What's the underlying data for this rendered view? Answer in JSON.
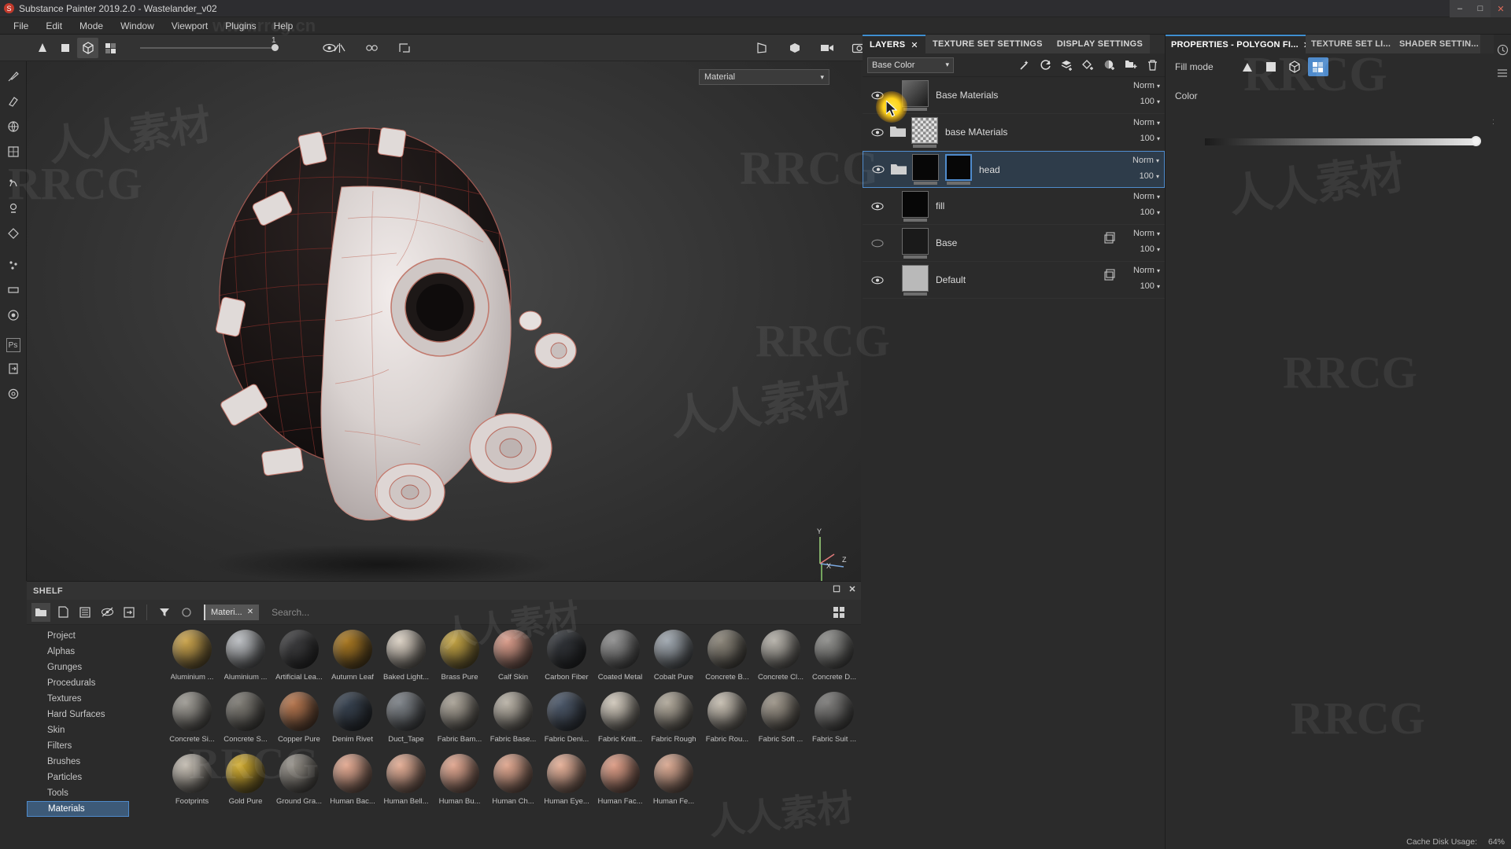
{
  "window": {
    "title": "Substance Painter 2019.2.0 - Wastelander_v02",
    "app_icon": "substance-logo-icon",
    "minimize": "–",
    "maximize": "□",
    "close": "✕"
  },
  "menu": {
    "items": [
      "File",
      "Edit",
      "Mode",
      "Window",
      "Viewport",
      "Plugins",
      "Help"
    ]
  },
  "toolbar": {
    "slider_value": "1",
    "left_tools": [
      "cursor-tool-icon",
      "square-select-icon",
      "cube-3d-icon",
      "checker-uv-icon"
    ],
    "right_tools": [
      "symmetry-icon",
      "symmetry-mirror-icon",
      "transform-icon"
    ],
    "far_tools": [
      "screen-icon",
      "cube-view-icon",
      "camera-view-icon",
      "screenshot-icon"
    ]
  },
  "left_rail": {
    "tools": [
      "paint-brush-icon",
      "eraser-icon",
      "projection-icon",
      "polygon-fill-icon",
      "smudge-icon",
      "clone-stamp-icon",
      "geometry-decal-icon",
      "particle-icon",
      "blur-icon",
      "material-icon",
      "photoshop-icon",
      "export-icon",
      "settings-icon"
    ]
  },
  "viewport": {
    "material_dropdown": "Material",
    "chevron": "∨",
    "axis_labels": [
      "Y",
      "X",
      "Z"
    ]
  },
  "shelf": {
    "title": "SHELF",
    "float_icon": "float-window-icon",
    "close_icon": "✕",
    "toolbar_icons": [
      "folder-icon",
      "new-file-icon",
      "save-icon",
      "hide-icon",
      "import-icon",
      "filter-icon",
      "reset-icon"
    ],
    "active_chip": "Materi...",
    "chip_close": "✕",
    "search_placeholder": "Search...",
    "grid_toggle_icon": "grid-view-icon",
    "categories": [
      {
        "label": "Project",
        "selected": false
      },
      {
        "label": "Alphas",
        "selected": false
      },
      {
        "label": "Grunges",
        "selected": false
      },
      {
        "label": "Procedurals",
        "selected": false
      },
      {
        "label": "Textures",
        "selected": false
      },
      {
        "label": "Hard Surfaces",
        "selected": false
      },
      {
        "label": "Skin",
        "selected": false
      },
      {
        "label": "Filters",
        "selected": false
      },
      {
        "label": "Brushes",
        "selected": false
      },
      {
        "label": "Particles",
        "selected": false
      },
      {
        "label": "Tools",
        "selected": false
      },
      {
        "label": "Materials",
        "selected": true
      }
    ],
    "materials": [
      {
        "label": "Aluminium ...",
        "color": "#c9a24a"
      },
      {
        "label": "Aluminium ...",
        "color": "#b9bcc0"
      },
      {
        "label": "Artificial Lea...",
        "color": "#3a3a3c"
      },
      {
        "label": "Autumn Leaf",
        "color": "#a7761f"
      },
      {
        "label": "Baked Light...",
        "color": "#d9cfc2"
      },
      {
        "label": "Brass Pure",
        "color": "#c2a241"
      },
      {
        "label": "Calf Skin",
        "color": "#d89a88"
      },
      {
        "label": "Carbon Fiber",
        "color": "#2e3136"
      },
      {
        "label": "Coated Metal",
        "color": "#8e8e8e"
      },
      {
        "label": "Cobalt Pure",
        "color": "#9ea6ae"
      },
      {
        "label": "Concrete B...",
        "color": "#8a8478"
      },
      {
        "label": "Concrete Cl...",
        "color": "#b4b0a8"
      },
      {
        "label": "Concrete D...",
        "color": "#8d8d8a"
      },
      {
        "label": "Concrete Si...",
        "color": "#9d9a93"
      },
      {
        "label": "Concrete S...",
        "color": "#7e7b74"
      },
      {
        "label": "Copper Pure",
        "color": "#b4744c"
      },
      {
        "label": "Denim Rivet",
        "color": "#35404e"
      },
      {
        "label": "Duct_Tape",
        "color": "#7c8187"
      },
      {
        "label": "Fabric Bam...",
        "color": "#a9a296"
      },
      {
        "label": "Fabric Base...",
        "color": "#b9b2a6"
      },
      {
        "label": "Fabric Deni...",
        "color": "#4a5668"
      },
      {
        "label": "Fabric Knitt...",
        "color": "#cfc7ba"
      },
      {
        "label": "Fabric Rough",
        "color": "#b0a89a"
      },
      {
        "label": "Fabric Rou...",
        "color": "#c5bdb0"
      },
      {
        "label": "Fabric Soft ...",
        "color": "#9c9488"
      },
      {
        "label": "Fabric Suit ...",
        "color": "#7b7a78"
      },
      {
        "label": "Footprints",
        "color": "#c3bcb1"
      },
      {
        "label": "Gold Pure",
        "color": "#cfa92b"
      },
      {
        "label": "Ground Gra...",
        "color": "#8f8a82"
      },
      {
        "label": "Human Bac...",
        "color": "#e2a890"
      },
      {
        "label": "Human Bell...",
        "color": "#e3ad95"
      },
      {
        "label": "Human Bu...",
        "color": "#e0a68f"
      },
      {
        "label": "Human Ch...",
        "color": "#dfa68e"
      },
      {
        "label": "Human Eye...",
        "color": "#e5b098"
      },
      {
        "label": "Human Fac...",
        "color": "#dc9c85"
      },
      {
        "label": "Human Fe...",
        "color": "#d9a891"
      }
    ]
  },
  "layers_panel": {
    "tabs": [
      {
        "label": "LAYERS",
        "active": true,
        "closable": true
      },
      {
        "label": "TEXTURE SET SETTINGS",
        "active": false,
        "closable": false
      },
      {
        "label": "DISPLAY SETTINGS",
        "active": false,
        "closable": false
      }
    ],
    "close_glyph": "✕",
    "channel": "Base Color",
    "channel_chevron": "∨",
    "tool_icons": [
      "magic-effect-icon",
      "add-smart-mask-icon",
      "add-fill-layer-icon",
      "add-paint-layer-icon",
      "add-adjustment-icon",
      "add-folder-icon",
      "delete-icon"
    ],
    "layers": [
      {
        "name": "Base Materials",
        "blend": "Norm",
        "opacity": "100",
        "visible": true,
        "kind": "fill-layer",
        "selected": false,
        "has_folder": false,
        "thumb": "thumb-mask"
      },
      {
        "name": "base MAterials",
        "blend": "Norm",
        "opacity": "100",
        "visible": true,
        "kind": "folder",
        "selected": false,
        "has_folder": true,
        "thumb": "thumb-checker"
      },
      {
        "name": "head",
        "blend": "Norm",
        "opacity": "100",
        "visible": true,
        "kind": "folder",
        "selected": true,
        "has_folder": true,
        "thumb": "thumb-black"
      },
      {
        "name": "fill",
        "blend": "Norm",
        "opacity": "100",
        "visible": true,
        "kind": "fill-layer",
        "selected": false,
        "has_folder": false,
        "thumb": "thumb-black"
      },
      {
        "name": "Base",
        "blend": "Norm",
        "opacity": "100",
        "visible": false,
        "kind": "paint-layer",
        "selected": false,
        "has_folder": false,
        "thumb": "thumb-gray"
      },
      {
        "name": "Default",
        "blend": "Norm",
        "opacity": "100",
        "visible": true,
        "kind": "paint-layer",
        "selected": false,
        "has_folder": false,
        "thumb": "thumb-lightgray"
      }
    ],
    "blend_chevron": "∨"
  },
  "properties_panel": {
    "tabs": [
      {
        "label": "PROPERTIES - POLYGON FI...",
        "active": true,
        "closable": true
      },
      {
        "label": "TEXTURE SET LI...",
        "active": false,
        "closable": false
      },
      {
        "label": "SHADER SETTIN...",
        "active": false,
        "closable": false
      }
    ],
    "close_glyph": "✕",
    "fill_mode_label": "Fill mode",
    "fill_modes": [
      "triangle-fill-icon",
      "uv-quad-fill-icon",
      "uv-shell-fill-icon",
      "mesh-fill-icon"
    ],
    "fill_mode_active_index": 3,
    "color_label": "Color",
    "gradient_value": "1"
  },
  "right_rail": {
    "icons": [
      "history-icon",
      "list-icon"
    ]
  },
  "status_bar": {
    "cache": "Cache Disk Usage:",
    "percent": "64%"
  },
  "watermarks": {
    "primary": "RRCG",
    "secondary": "人人素材",
    "url": "www.rrcg.cn"
  },
  "theme": {
    "accent": "#3f8fd0",
    "selection": "#4f8bcc",
    "panel_bg": "#2b2b2b",
    "toolbar_bg": "#333333",
    "glow": "#ffd21a"
  }
}
